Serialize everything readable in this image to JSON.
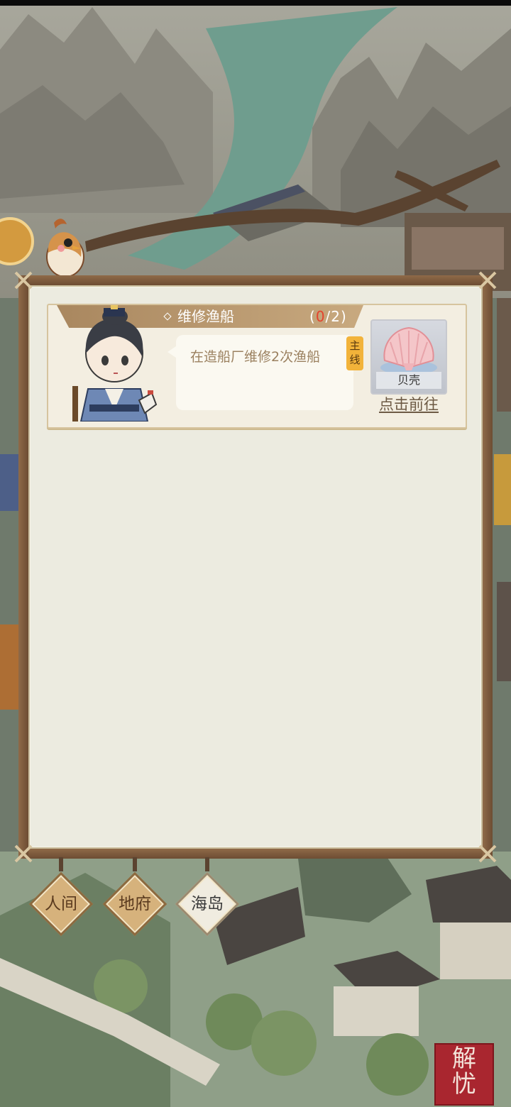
{
  "quest": {
    "title": "维修渔船",
    "progress_current": "0",
    "progress_total": "/2",
    "progress_open": "(",
    "progress_close": ")",
    "description": "在造船厂维修2次渔船",
    "tag_main_1": "主",
    "tag_main_2": "线",
    "reward_name": "贝壳",
    "goto_label": "点击前往"
  },
  "tabs": [
    {
      "label": "人间",
      "active": false
    },
    {
      "label": "地府",
      "active": false
    },
    {
      "label": "海岛",
      "active": true
    }
  ],
  "seal": {
    "char1": "解",
    "char2": "忧"
  },
  "colors": {
    "board": "#ecebe0",
    "frame": "#7a5838",
    "ribbon": "#b89a72",
    "progress_current": "#e4432d",
    "tag": "#f2b33a"
  },
  "icons": {
    "reward": "shell-icon",
    "bird": "sparrow-mascot",
    "avatar": "scholar-character"
  }
}
